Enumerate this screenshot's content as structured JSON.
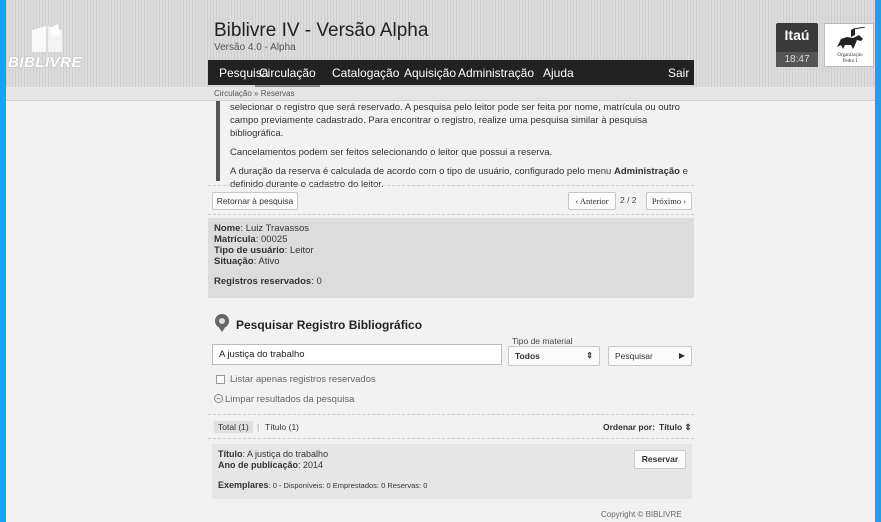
{
  "header": {
    "logo_text": "BIBLIVRE",
    "app_title": "Biblivre IV - Versão Alpha",
    "app_subtitle": "Versão 4.0 - Alpha",
    "nav": [
      "Pesquisa",
      "Circulação",
      "Catalogação",
      "Aquisição",
      "Administração",
      "Ajuda"
    ],
    "logout": "Sair",
    "bank": {
      "name": "Itaú",
      "time": "18:47"
    },
    "org": {
      "line1": "Organização",
      "line2": "Pedro I"
    }
  },
  "breadcrumb": {
    "section": "Circulação",
    "separator": "»",
    "page": "Reservas"
  },
  "help": {
    "p1": "selecionar o registro que será reservado. A pesquisa pelo leitor pode ser feita por nome, matrícula ou outro campo previamente cadastrado. Para encontrar o registro, realize uma pesquisa similar à pesquisa bibliográfica.",
    "p2": "Cancelamentos podem ser feitos selecionando o leitor que possui a reserva.",
    "p3_a": "A duração da reserva é calculada de acordo com o tipo de usuário, configurado pelo menu ",
    "p3_b": "Administração",
    "p3_c": " e definido durante o cadastro do leitor."
  },
  "paging": {
    "back": "Retornar à pesquisa",
    "prev": "‹ Anterior",
    "count": "2 / 2",
    "next": "Próximo ›"
  },
  "reader": {
    "name_label": "Nome",
    "name": "Luiz Travassos",
    "id_label": "Matrícula",
    "id": "00025",
    "type_label": "Tipo de usuário",
    "type": "Leitor",
    "status_label": "Situação",
    "status": "Ativo",
    "reserved_label": "Registros reservados",
    "reserved": "0"
  },
  "search": {
    "title": "Pesquisar Registro Bibliográfico",
    "query": "A justiça do trabalho",
    "material_label": "Tipo de material",
    "material_value": "Todos",
    "search_button": "Pesquisar",
    "only_reserved": "Listar apenas registros reservados",
    "clear": "Limpar resultados da pesquisa"
  },
  "results": {
    "tab_total": "Total (1)",
    "tab_title": "Título (1)",
    "sort_label": "Ordenar por:",
    "sort_value": "Título",
    "item": {
      "title_label": "Título",
      "title": "A justiça do trabalho",
      "year_label": "Ano de publicação",
      "year": "2014",
      "copies_label": "Exemplares",
      "copies": "0 - Disponíveis: 0 Emprestados: 0 Reservas: 0",
      "reserve_button": "Reservar"
    }
  },
  "footer": {
    "copyright": "Copyright © BIBLIVRE"
  },
  "colors": {
    "frame": "#1aa3e8",
    "nav_bg": "#222222",
    "panel": "#dcdcdc"
  }
}
